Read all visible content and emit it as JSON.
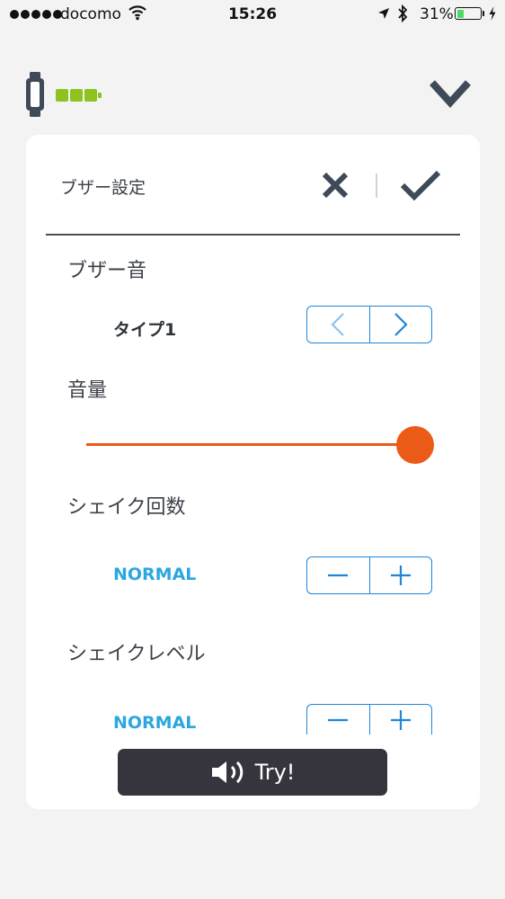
{
  "status_bar": {
    "carrier": "docomo",
    "time": "15:26",
    "battery_percent": "31%",
    "battery_level": 0.31,
    "icons": [
      "signal-dots-icon",
      "wifi-icon",
      "location-arrow-icon",
      "bluetooth-icon",
      "battery-icon",
      "charging-bolt-icon"
    ]
  },
  "header": {
    "device_icon": "wristband-device-icon",
    "device_battery_icon": "device-battery-icon",
    "device_battery_segments": 3,
    "collapse_icon": "chevron-down-icon"
  },
  "dialog": {
    "title": "ブザー設定",
    "cancel_icon": "close-icon",
    "confirm_icon": "checkmark-icon",
    "buzzer_sound": {
      "label": "ブザー音",
      "value": "タイプ1",
      "prev_icon": "chevron-left-icon",
      "next_icon": "chevron-right-icon"
    },
    "volume": {
      "label": "音量",
      "level": 1.0
    },
    "shake_count": {
      "label": "シェイク回数",
      "value": "NORMAL",
      "minus_icon": "minus-icon",
      "plus_icon": "plus-icon"
    },
    "shake_level": {
      "label": "シェイクレベル",
      "value": "NORMAL",
      "minus_icon": "minus-icon",
      "plus_icon": "plus-icon"
    },
    "try_button": {
      "label": "Try!",
      "icon": "speaker-icon"
    }
  },
  "colors": {
    "accent_blue": "#1f86d8",
    "value_blue": "#2aa7de",
    "slider_orange": "#ec5a17",
    "battery_green": "#8dc21f",
    "button_dark": "#36353d",
    "icon_dark": "#3e4a57"
  }
}
